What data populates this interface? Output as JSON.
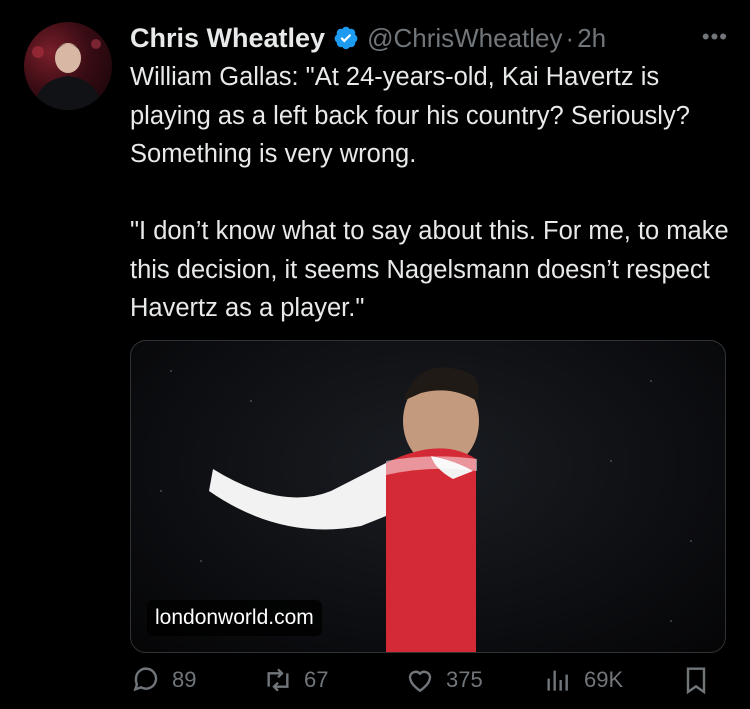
{
  "author": {
    "name": "Chris Wheatley",
    "handle": "@ChrisWheatley",
    "time": "2h"
  },
  "tweet": {
    "paragraph1": "William Gallas: \"At 24-years-old, Kai Havertz is playing as a left back four his country? Seriously? Something is very wrong.",
    "paragraph2": "\"I don’t know what to say about this. For me, to make this decision, it seems Nagelsmann doesn’t respect Havertz as a player.\""
  },
  "media": {
    "source_label": "londonworld.com"
  },
  "actions": {
    "replies": "89",
    "reposts": "67",
    "likes": "375",
    "views": "69K"
  },
  "colors": {
    "background": "#000000",
    "text": "#e7e9ea",
    "muted": "#71767b",
    "verified": "#1d9bf0"
  }
}
